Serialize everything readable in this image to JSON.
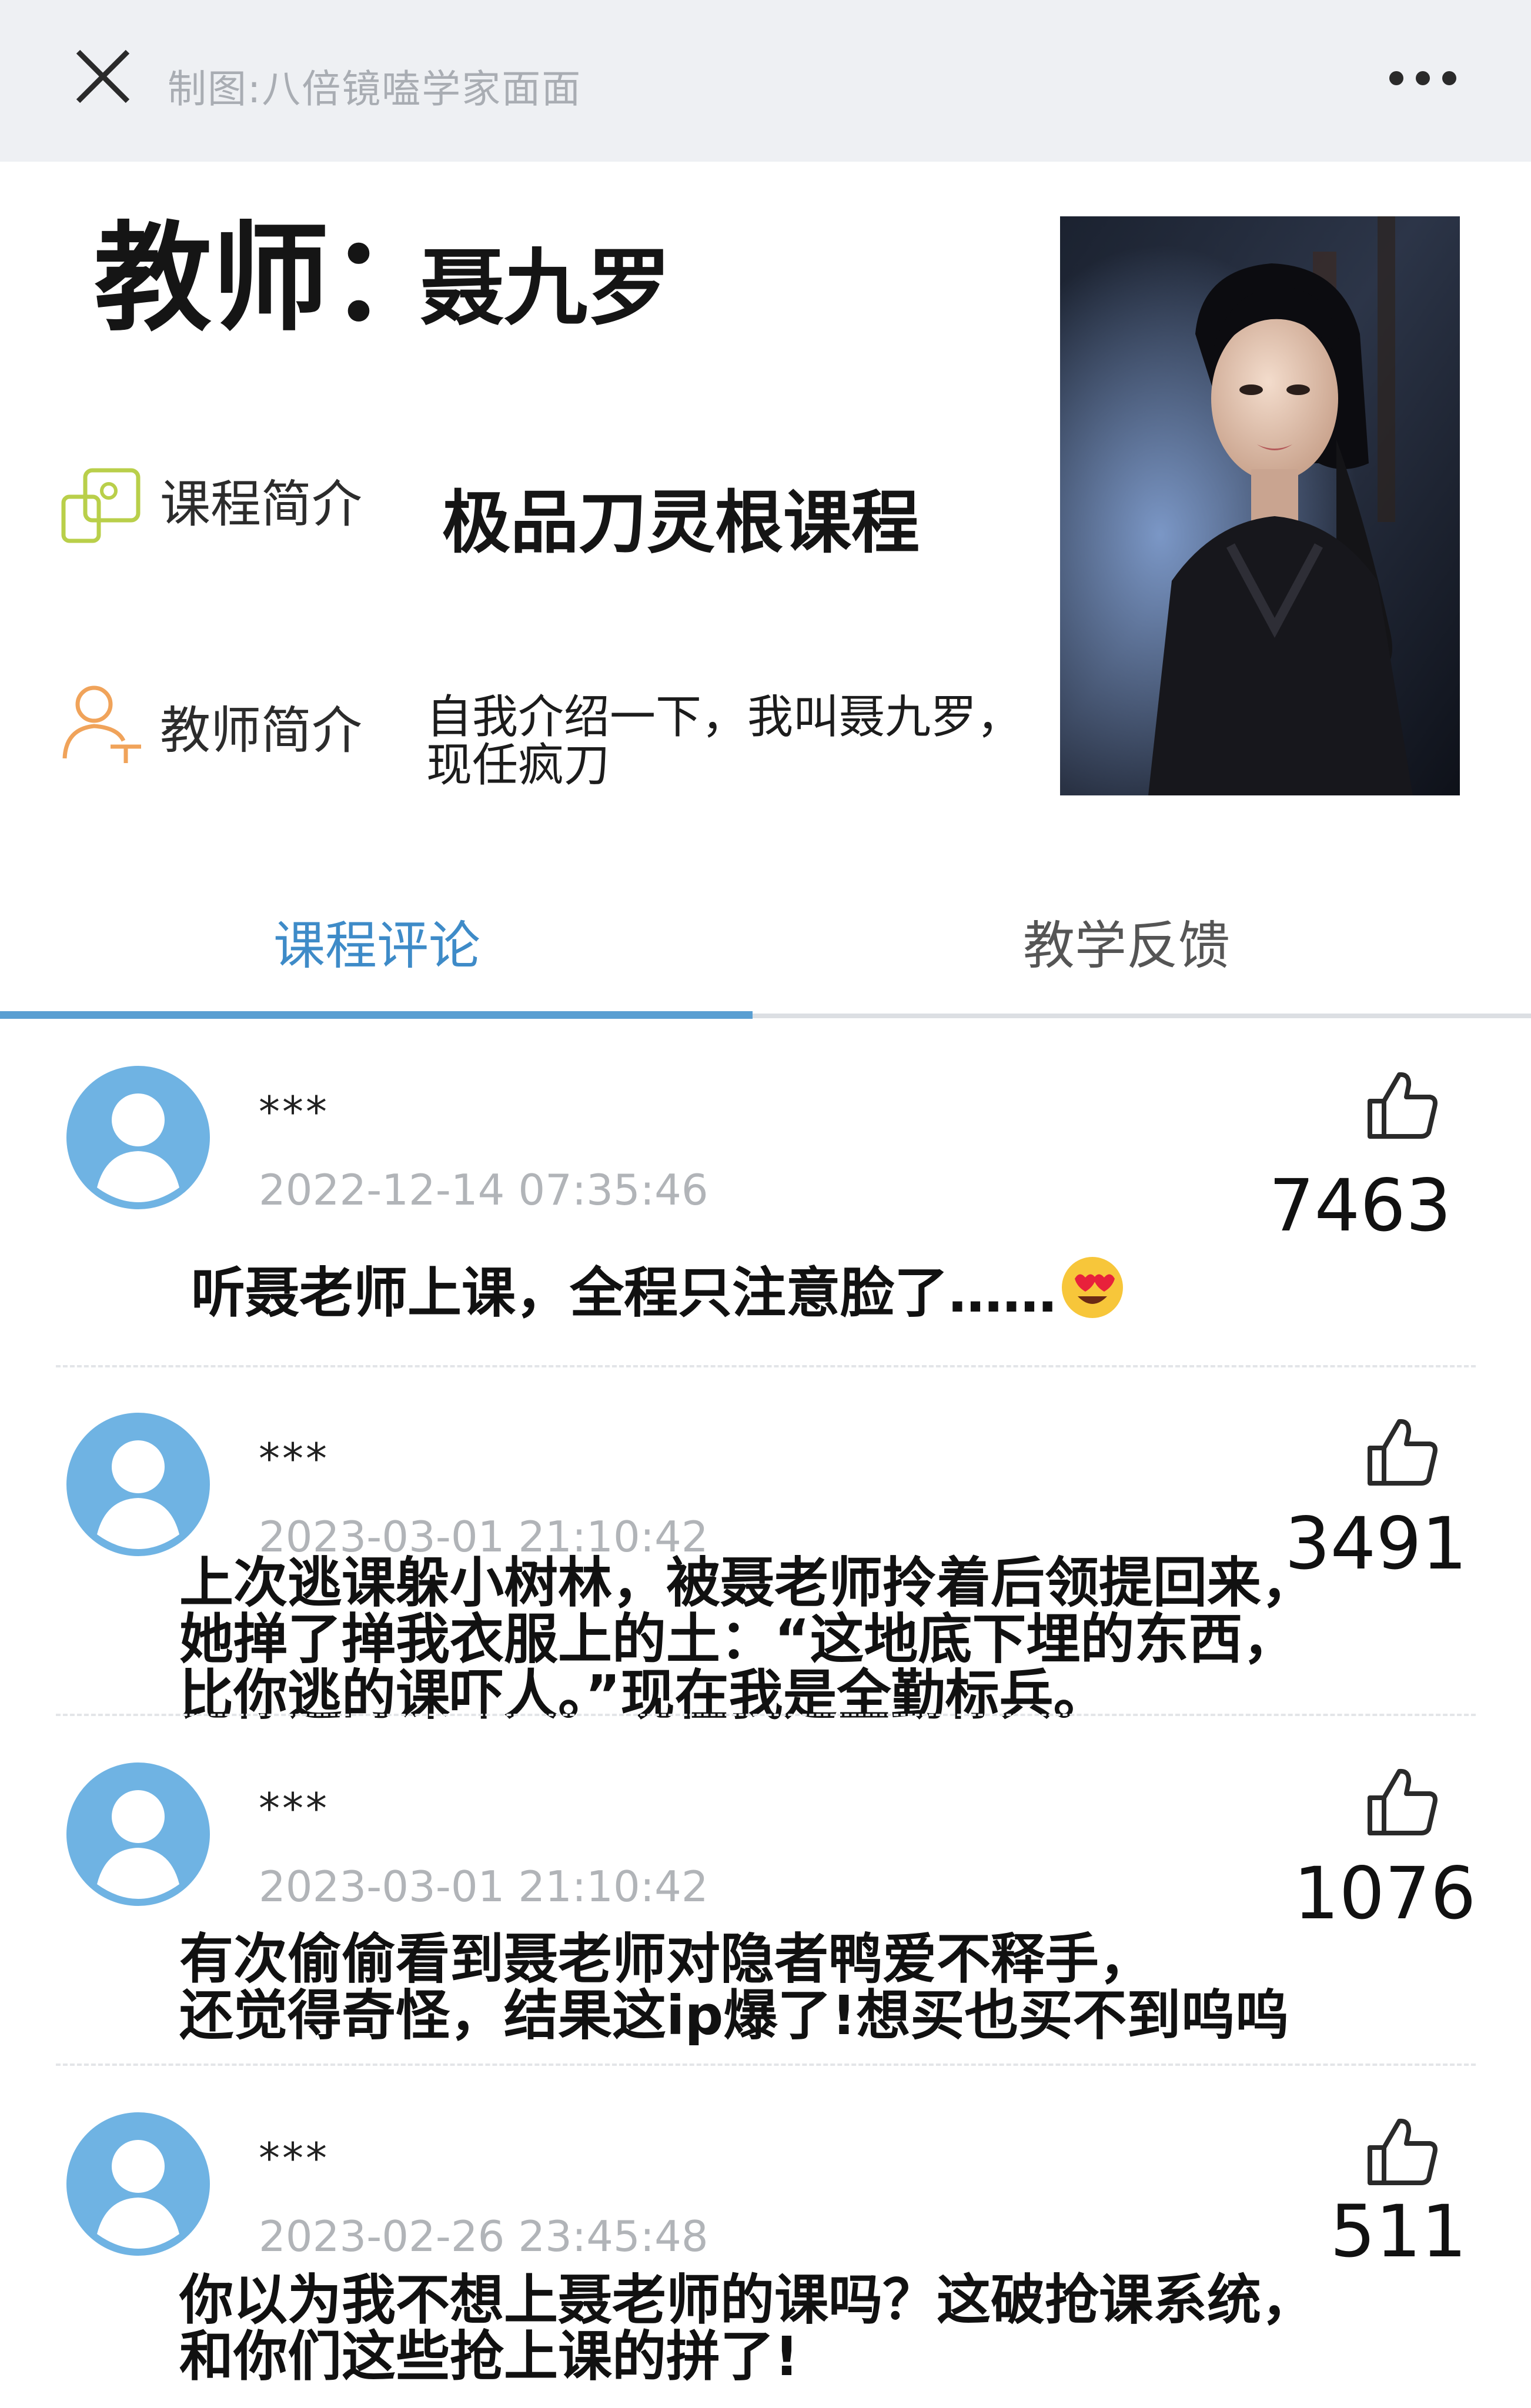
{
  "topbar": {
    "title": "制图:八倍镜嗑学家面面",
    "close_icon": "close-icon",
    "more_icon": "more-icon"
  },
  "teacher": {
    "title_label": "教师：",
    "name": "聂九罗",
    "course_label": "课程简介",
    "course_value": "极品刀灵根课程",
    "bio_label": "教师简介",
    "bio_value": "自我介绍一下，我叫聂九罗，现任疯刀"
  },
  "tabs": [
    {
      "label": "课程评论",
      "active": true
    },
    {
      "label": "教学反馈",
      "active": false
    }
  ],
  "colors": {
    "accent": "#3e8bc8",
    "avatar": "#6fb3e3",
    "icon_green": "#b9cf4a",
    "icon_orange": "#f0a35a"
  },
  "comments": [
    {
      "user": "***",
      "time": "2022-12-14 07:35:46",
      "likes": "7463",
      "text": "听聂老师上课，全程只注意脸了……",
      "emoji": "heart-eyes-emoji"
    },
    {
      "user": "***",
      "time": "2023-03-01 21:10:42",
      "likes": "3491",
      "lines": [
        "上次逃课躲小树林，被聂老师拎着后领提回来，",
        "她掸了掸我衣服上的土：“这地底下埋的东西，",
        "比你逃的课吓人。”现在我是全勤标兵。"
      ]
    },
    {
      "user": "***",
      "time": "2023-03-01 21:10:42",
      "likes": "1076",
      "lines": [
        "有次偷偷看到聂老师对隐者鸭爱不释手，",
        "还觉得奇怪，结果这ip爆了!想买也买不到呜呜"
      ]
    },
    {
      "user": "***",
      "time": "2023-02-26 23:45:48",
      "likes": "511",
      "lines": [
        "你以为我不想上聂老师的课吗？这破抢课系统，",
        "和你们这些抢上课的拼了!"
      ]
    }
  ]
}
